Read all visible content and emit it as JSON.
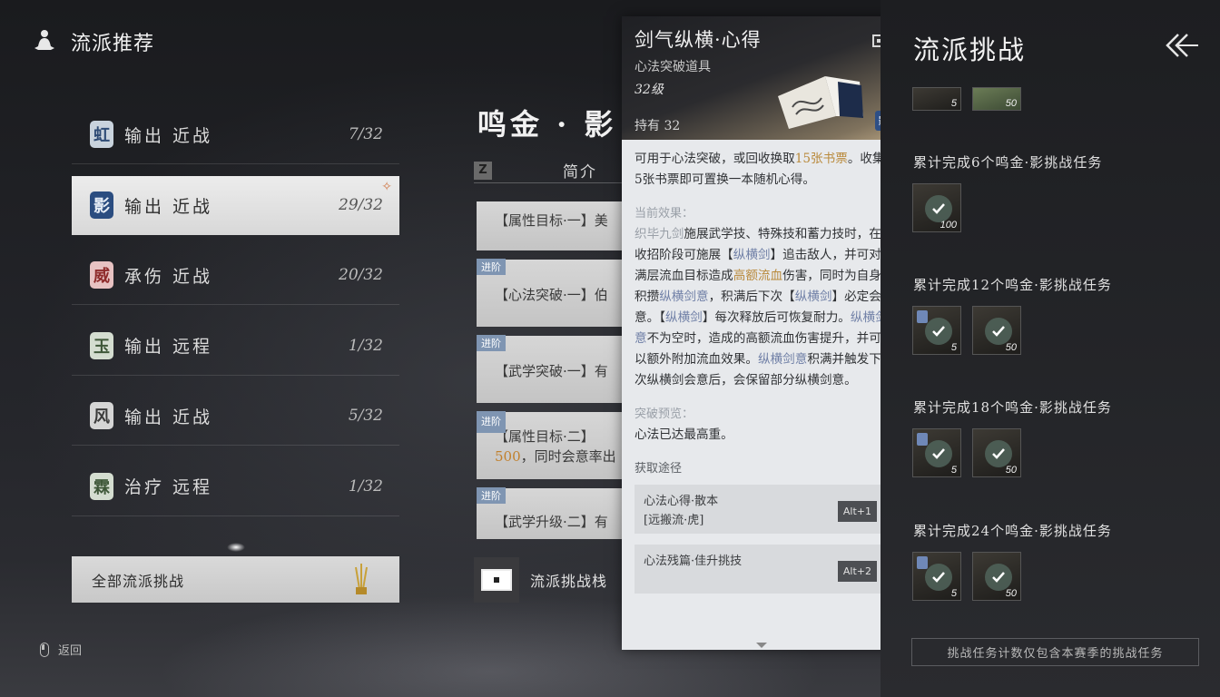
{
  "header": {
    "title": "流派推荐",
    "icon": "meditation-icon"
  },
  "schools": [
    {
      "seal": "虹",
      "role": "输出 近战",
      "count": "7/32",
      "seal_color": "blue",
      "active": false
    },
    {
      "seal": "影",
      "role": "输出 近战",
      "count": "29/32",
      "seal_color": "blue",
      "active": true
    },
    {
      "seal": "威",
      "role": "承伤 近战",
      "count": "20/32",
      "seal_color": "red",
      "active": false
    },
    {
      "seal": "玉",
      "role": "输出 远程",
      "count": "1/32",
      "seal_color": "green",
      "active": false
    },
    {
      "seal": "风",
      "role": "输出 近战",
      "count": "5/32",
      "seal_color": "gray",
      "active": false
    },
    {
      "seal": "霖",
      "role": "治疗 远程",
      "count": "1/32",
      "seal_color": "green",
      "active": false
    }
  ],
  "all_challenge": "全部流派挑战",
  "back": "返回",
  "middle": {
    "title": "鸣金 · 影",
    "z_key": "Z",
    "tab": "简介",
    "cards": [
      {
        "tag": "",
        "text": "【属性目标·一】美"
      },
      {
        "tag": "进阶",
        "text": "【心法突破·一】伯"
      },
      {
        "tag": "进阶",
        "text": "【武学突破·一】有"
      },
      {
        "tag": "进阶",
        "text": "【属性目标·二】",
        "text2_hl": "500",
        "text2": "，同时会意率出"
      },
      {
        "tag": "进阶",
        "text": "【武学升级·二】有"
      }
    ],
    "bottom_label": "流派挑战栈"
  },
  "popup": {
    "name": "剑气纵横·心得",
    "type": "心法突破道具",
    "level": "32级",
    "owned": "持有 32",
    "desc_1": "可用于心法突破，或回收换取",
    "desc_hl": "15张书票",
    "desc_2": "。收集5张书票即可置换一本随机心得。",
    "effect_title": "当前效果：",
    "effect_0": "织毕九剑",
    "effect_1": "施展武学技、特殊技和蓄力技时，在收招阶段可施展【",
    "effect_2": "纵横剑",
    "effect_3": "】追击敌人，并可对满层流血目标造成",
    "effect_4": "高额流血",
    "effect_5": "伤害，同时为自身积攒",
    "effect_6": "纵横剑意",
    "effect_7": "，积满后下次【",
    "effect_8": "纵横剑",
    "effect_9": "】必定会意。【",
    "effect_10": "纵横剑",
    "effect_11": "】每次释放后可恢复耐力。",
    "effect_12": "纵横剑意",
    "effect_13": "不为空时，造成的高额流血伤害提升，并可以额外附加流血效果。",
    "effect_14": "纵横剑意",
    "effect_15": "积满并触发下次纵横剑会意后，会保留部分纵横剑意。",
    "preview_title": "突破预览：",
    "preview_text": "心法已达最高重。",
    "source_title": "获取途径",
    "routes": [
      {
        "line1": "心法心得·散本",
        "line2": "[远搬流·虎]",
        "key": "Alt+1"
      },
      {
        "line1": "心法残篇·佳升挑技",
        "line2": "",
        "key": "Alt+2"
      }
    ]
  },
  "right": {
    "title": "流派挑战",
    "back_icon": "double-chevron-left-icon",
    "top_rewards": [
      {
        "qty": "5"
      },
      {
        "qty": "50"
      }
    ],
    "tasks": [
      {
        "label": "累计完成6个鸣金·影挑战任务",
        "rewards": [
          {
            "qty": "100",
            "done": true
          }
        ]
      },
      {
        "label": "累计完成12个鸣金·影挑战任务",
        "rewards": [
          {
            "qty": "5",
            "done": true
          },
          {
            "qty": "50",
            "done": true
          }
        ]
      },
      {
        "label": "累计完成18个鸣金·影挑战任务",
        "rewards": [
          {
            "qty": "5",
            "done": true
          },
          {
            "qty": "50",
            "done": true
          }
        ]
      },
      {
        "label": "累计完成24个鸣金·影挑战任务",
        "rewards": [
          {
            "qty": "5",
            "done": true
          },
          {
            "qty": "50",
            "done": true
          }
        ]
      }
    ],
    "note": "挑战任务计数仅包含本赛季的挑战任务"
  }
}
